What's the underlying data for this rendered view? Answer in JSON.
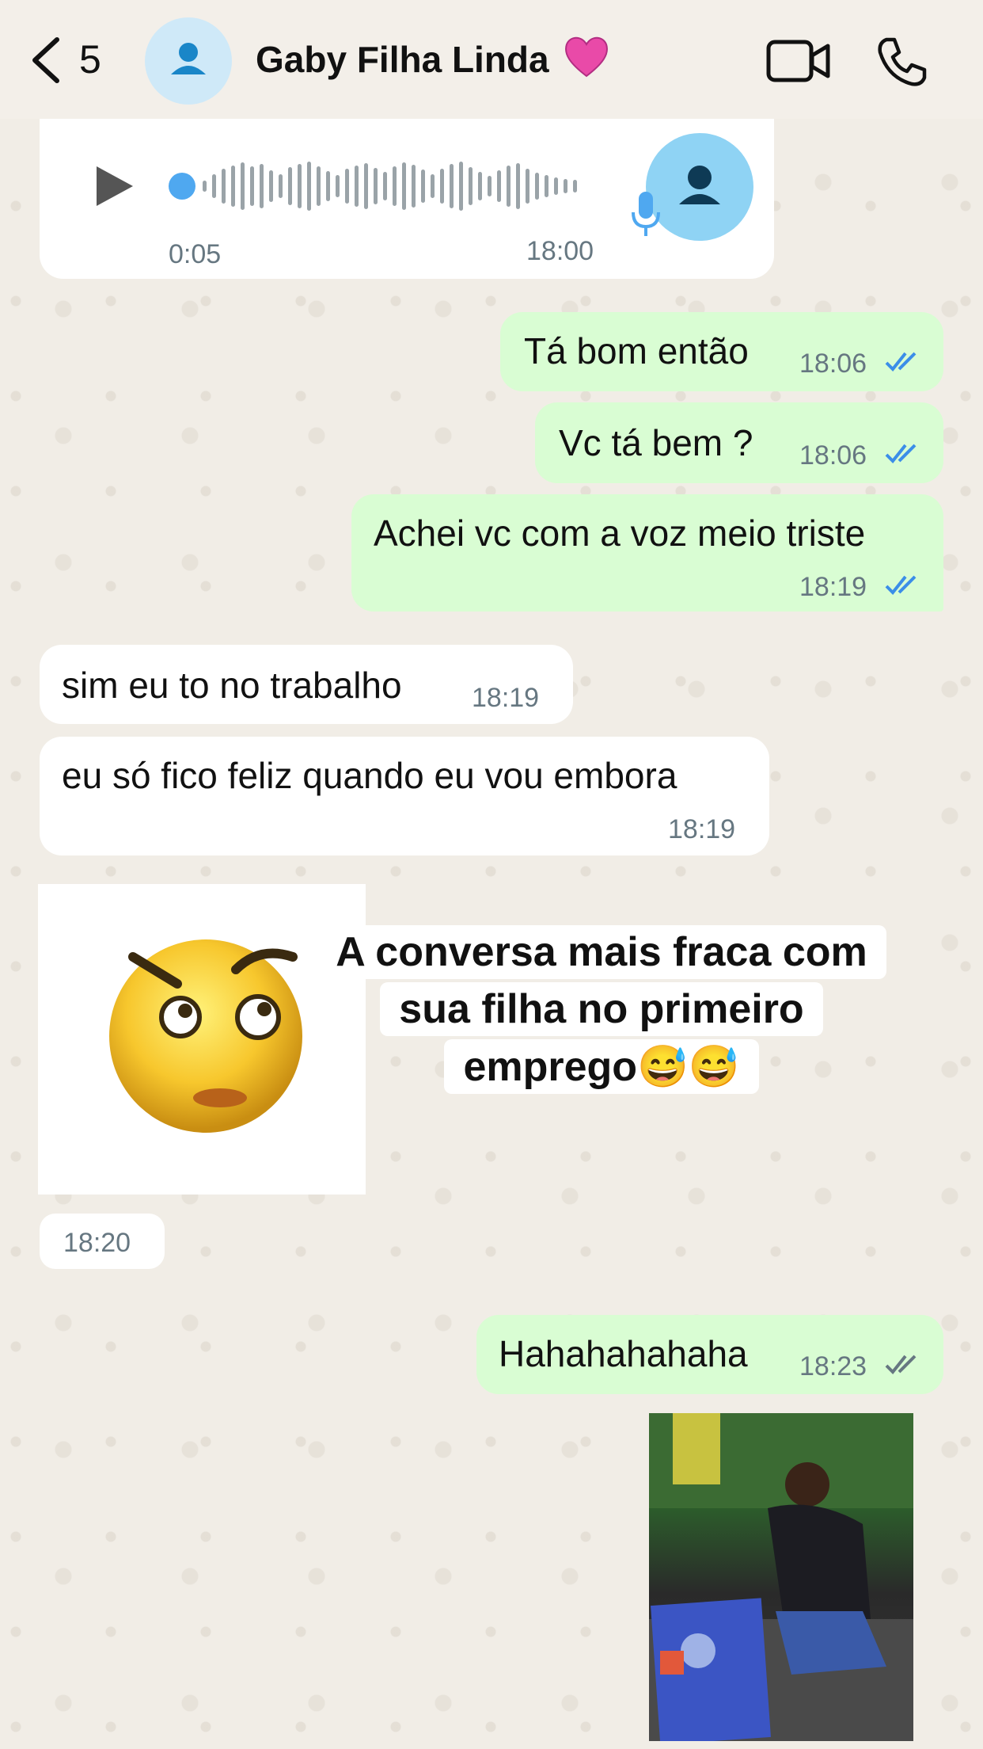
{
  "header": {
    "back_count": "5",
    "contact_name": "Gaby Filha Linda",
    "icons": [
      "chevron-left-icon",
      "person-icon",
      "heart-emoji-icon",
      "video-call-icon",
      "phone-icon"
    ]
  },
  "voice_message": {
    "duration": "0:05",
    "time": "18:00"
  },
  "messages": [
    {
      "direction": "out",
      "text": "Tá bom então",
      "time": "18:06",
      "status": "read"
    },
    {
      "direction": "out",
      "text": "Vc tá bem ?",
      "time": "18:06",
      "status": "read"
    },
    {
      "direction": "out",
      "text": "Achei vc com a voz meio triste",
      "time": "18:19",
      "status": "read"
    },
    {
      "direction": "in",
      "text": "sim eu to no trabalho",
      "time": "18:19"
    },
    {
      "direction": "in",
      "text": "eu só fico feliz quando eu vou embora",
      "time": "18:19"
    },
    {
      "direction": "in",
      "type": "sticker",
      "time": "18:20"
    },
    {
      "direction": "out",
      "text": "Hahahahahaha",
      "time": "18:23",
      "status": "delivered"
    },
    {
      "direction": "out",
      "type": "video"
    }
  ],
  "overlay_caption": {
    "line1": "A conversa mais fraca com",
    "line2": "sua filha no primeiro",
    "line3": "emprego😅😅"
  },
  "colors": {
    "outgoing_bubble": "#d9fdd3",
    "incoming_bubble": "#ffffff",
    "read_ticks": "#3b8ee8",
    "delivered_ticks": "#667781",
    "voice_accent": "#4fa8f0"
  }
}
